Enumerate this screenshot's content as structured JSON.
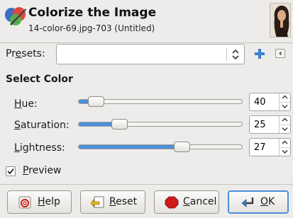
{
  "dialog": {
    "title": "Colorize the Image",
    "subtitle": "14-color-69.jpg-703 (Untitled)"
  },
  "presets": {
    "label_pre": "Pr",
    "label_mnemonic": "e",
    "label_post": "sets:",
    "value": ""
  },
  "select_color": {
    "title": "Select Color",
    "hue": {
      "label_mnemonic": "H",
      "label_rest": "ue:",
      "value": "40",
      "fraction": 0.11
    },
    "saturation": {
      "label_mnemonic": "S",
      "label_rest": "aturation:",
      "value": "25",
      "fraction": 0.25
    },
    "lightness": {
      "label_mnemonic": "L",
      "label_rest": "ightness:",
      "value": "27",
      "fraction": 0.63
    }
  },
  "preview": {
    "checked": true,
    "label_mnemonic": "P",
    "label_rest": "review"
  },
  "buttons": {
    "help": {
      "mnemonic": "H",
      "rest": "elp",
      "icon": "help-icon"
    },
    "reset": {
      "mnemonic": "R",
      "rest": "eset",
      "icon": "reset-icon"
    },
    "cancel": {
      "mnemonic": "C",
      "rest": "ancel",
      "icon": "cancel-icon"
    },
    "ok": {
      "mnemonic": "O",
      "rest": "K",
      "icon": "ok-icon"
    }
  },
  "colors": {
    "accent": "#4a90d9",
    "cancel_red": "#d11a1a",
    "add_blue": "#3a7fd0"
  }
}
